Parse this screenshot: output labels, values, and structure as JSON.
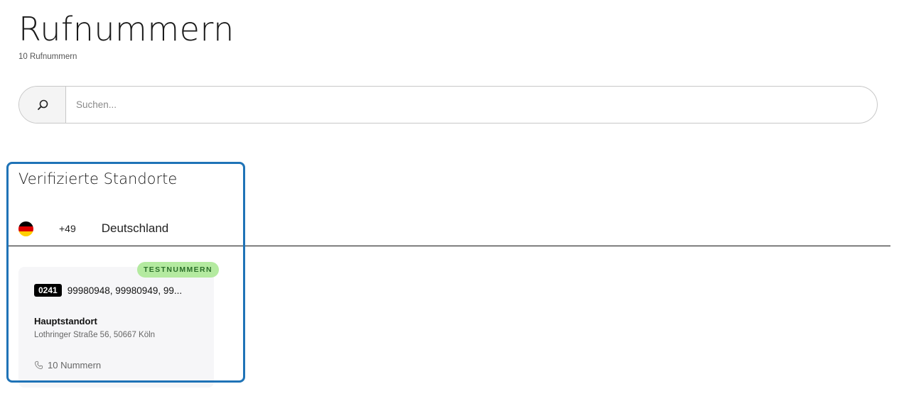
{
  "header": {
    "title": "Rufnummern",
    "subtitle": "10 Rufnummern"
  },
  "search": {
    "placeholder": "Suchen...",
    "value": "",
    "icon": "search-icon"
  },
  "section": {
    "title": "Verifizierte Standorte"
  },
  "country": {
    "flag": "germany-flag-icon",
    "dial_code": "+49",
    "name": "Deutschland"
  },
  "cards": [
    {
      "badge": "TESTNUMMERN",
      "area_code": "0241",
      "numbers": "99980948, 99980949, 99...",
      "location_name": "Hauptstandort",
      "address": "Lothringer Straße 56, 50667 Köln",
      "count_label": "10 Nummern",
      "count_icon": "phone-icon"
    }
  ],
  "colors": {
    "badge_bg": "#b4eaa0",
    "badge_text": "#2b6f2a",
    "selection": "#1f73b7",
    "area_code_bg": "#000000"
  }
}
